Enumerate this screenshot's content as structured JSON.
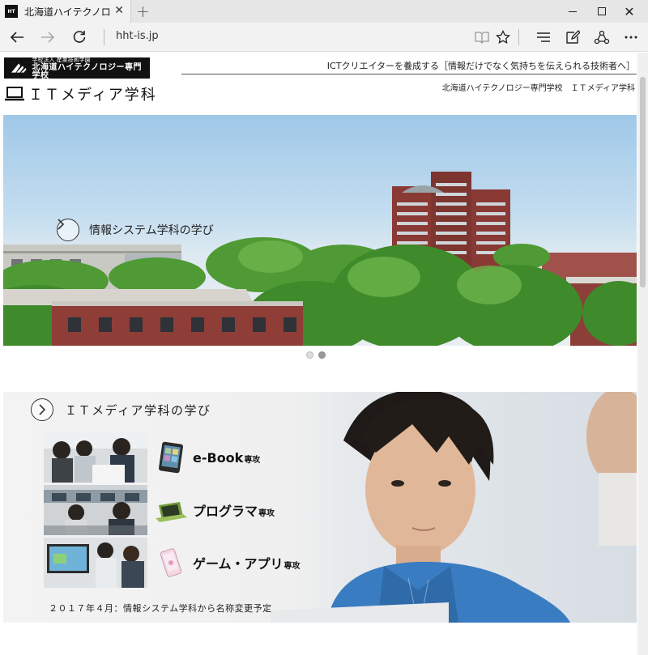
{
  "browser": {
    "tab_title": "北海道ハイテクノロジー専門",
    "favicon_text": "HT",
    "url": "hht-is.jp"
  },
  "header": {
    "logo_small": "学校法人 産業技術学園",
    "logo_big": "北海道ハイテクノロジー専門学校",
    "dept_name": "ＩＴメディア学科",
    "tagline": "ICTクリエイターを養成する［情報だけでなく気持ちを伝えられる技術者へ］",
    "school_line": "北海道ハイテクノロジー専門学校　ＩＴメディア学科"
  },
  "hero": {
    "link_label": "情報システム学科の学び"
  },
  "banner": {
    "title": "ＩＴメディア学科の学び",
    "courses": [
      {
        "name": "e-Book",
        "suffix": "専攻"
      },
      {
        "name": "プログラマ",
        "suffix": "専攻"
      },
      {
        "name": "ゲーム・アプリ",
        "suffix": "専攻"
      }
    ],
    "notice": "２０１７年４月：情報システム学科から名称変更予定"
  },
  "colors": {
    "accent_dark": "#111111",
    "sky": "#9fc8e8",
    "brick": "#8a3a35",
    "foliage": "#4f9a35"
  }
}
